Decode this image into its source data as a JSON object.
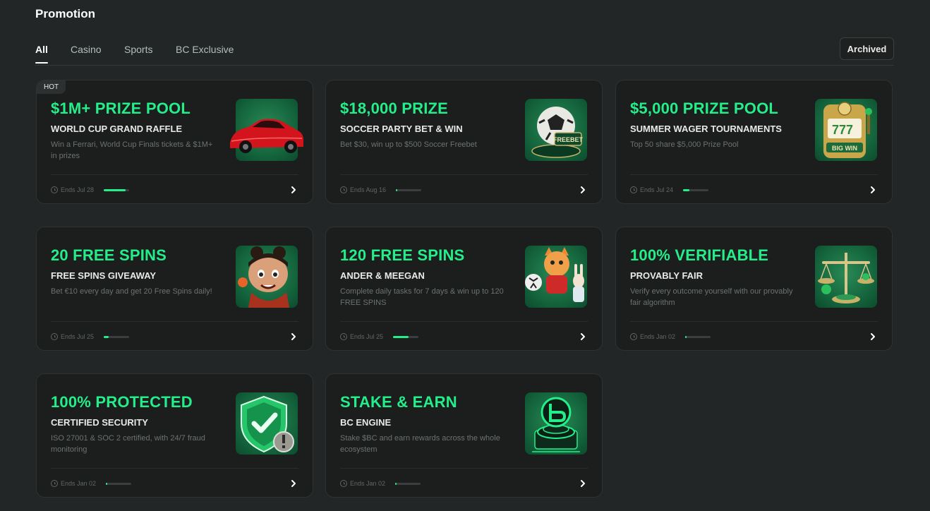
{
  "page": {
    "title": "Promotion"
  },
  "tabs": [
    {
      "label": "All",
      "active": true
    },
    {
      "label": "Casino",
      "active": false
    },
    {
      "label": "Sports",
      "active": false
    },
    {
      "label": "BC Exclusive",
      "active": false
    }
  ],
  "archived_label": "Archived",
  "accent_color": "#24ee89",
  "cards": [
    {
      "badge": "HOT",
      "title": "$1M+ PRIZE POOL",
      "subtitle": "WORLD CUP GRAND RAFFLE",
      "description": "Win a Ferrari, World Cup Finals tickets & $1M+ in prizes",
      "ends": "Ends Jul 28",
      "progress": 0.85,
      "icon": "red-sports-car-icon"
    },
    {
      "badge": "",
      "title": "$18,000 PRIZE",
      "subtitle": "SOCCER PARTY BET & WIN",
      "description": "Bet $30, win up to $500 Soccer Freebet",
      "ends": "Ends Aug 16",
      "progress": 0.05,
      "icon": "soccer-ball-freebet-icon"
    },
    {
      "badge": "",
      "title": "$5,000 PRIZE POOL",
      "subtitle": "SUMMER WAGER TOURNAMENTS",
      "description": "Top 50 share $5,000 Prize Pool",
      "ends": "Ends Jul 24",
      "progress": 0.25,
      "icon": "slot-machine-icon"
    },
    {
      "badge": "",
      "title": "20 FREE SPINS",
      "subtitle": "FREE SPINS GIVEAWAY",
      "description": "Bet €10 every day and get 20 Free Spins daily!",
      "ends": "Ends Jul 25",
      "progress": 0.2,
      "icon": "cartoon-kid-icon"
    },
    {
      "badge": "",
      "title": "120 FREE SPINS",
      "subtitle": "ANDER & MEEGAN",
      "description": "Complete daily tasks for 7 days & win up to 120 FREE SPINS",
      "ends": "Ends Jul 25",
      "progress": 0.6,
      "icon": "cat-and-rabbit-icon"
    },
    {
      "badge": "",
      "title": "100% VERIFIABLE",
      "subtitle": "PROVABLY FAIR",
      "description": "Verify every outcome yourself with our provably fair algorithm",
      "ends": "Ends Jan 02",
      "progress": 0.05,
      "icon": "balance-scale-icon"
    },
    {
      "badge": "",
      "title": "100% PROTECTED",
      "subtitle": "CERTIFIED SECURITY",
      "description": "ISO 27001 & SOC 2 certified, with 24/7 fraud monitoring",
      "ends": "Ends Jan 02",
      "progress": 0.05,
      "icon": "shield-check-icon"
    },
    {
      "badge": "",
      "title": "STAKE & EARN",
      "subtitle": "BC ENGINE",
      "description": "Stake $BC and earn rewards across the whole ecosystem",
      "ends": "Ends Jan 02",
      "progress": 0.05,
      "icon": "bc-engine-icon"
    }
  ]
}
